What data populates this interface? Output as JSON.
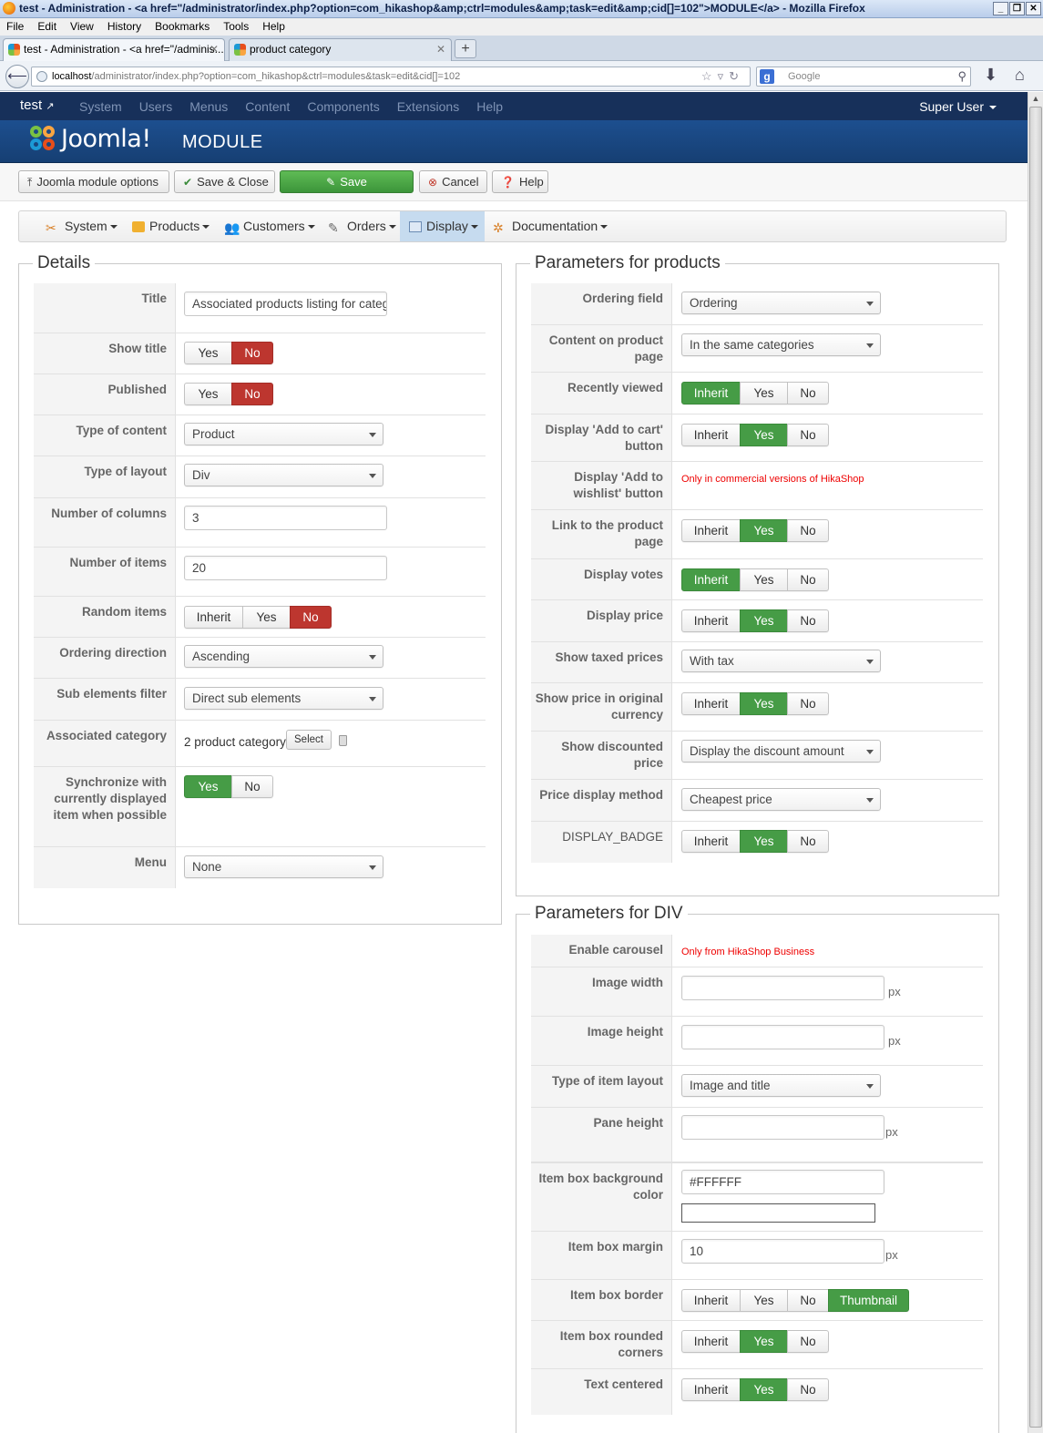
{
  "browser": {
    "window_title": "test - Administration - <a href=\"/administrator/index.php?option=com_hikashop&amp;ctrl=modules&amp;task=edit&amp;cid[]=102\">MODULE</a> - Mozilla Firefox",
    "menu": [
      "File",
      "Edit",
      "View",
      "History",
      "Bookmarks",
      "Tools",
      "Help"
    ],
    "tabs": [
      {
        "label": "test - Administration - <a href=\"/adminis..."
      },
      {
        "label": "product category"
      }
    ],
    "url_host": "localhost",
    "url_path": "/administrator/index.php?option=com_hikashop&ctrl=modules&task=edit&cid[]=102",
    "search_placeholder": "Google"
  },
  "joomla": {
    "site_name": "test",
    "menu": [
      "System",
      "Users",
      "Menus",
      "Content",
      "Components",
      "Extensions",
      "Help"
    ],
    "user": "Super User",
    "logo_text": "Joomla!",
    "page_title": "MODULE"
  },
  "toolbar": {
    "module_options": "Joomla module options",
    "save_close": "Save & Close",
    "save": "Save",
    "cancel": "Cancel",
    "help": "Help"
  },
  "hikanav": [
    "System",
    "Products",
    "Customers",
    "Orders",
    "Display",
    "Documentation"
  ],
  "details": {
    "legend": "Details",
    "title_label": "Title",
    "title_value": "Associated products listing for categ",
    "show_title_label": "Show title",
    "published_label": "Published",
    "type_content_label": "Type of content",
    "type_content_value": "Product",
    "type_layout_label": "Type of layout",
    "type_layout_value": "Div",
    "num_columns_label": "Number of columns",
    "num_columns_value": "3",
    "num_items_label": "Number of items",
    "num_items_value": "20",
    "random_label": "Random items",
    "ordering_dir_label": "Ordering direction",
    "ordering_dir_value": "Ascending",
    "sub_filter_label": "Sub elements filter",
    "sub_filter_value": "Direct sub elements",
    "assoc_cat_label": "Associated category",
    "assoc_cat_value": "2 product category",
    "select_btn": "Select",
    "sync_label": "Synchronize with currently displayed item when possible",
    "menu_label": "Menu",
    "menu_value": "None"
  },
  "buttons": {
    "yes": "Yes",
    "no": "No",
    "inherit": "Inherit",
    "thumbnail": "Thumbnail"
  },
  "products": {
    "legend": "Parameters for products",
    "ordering_field_label": "Ordering field",
    "ordering_field_value": "Ordering",
    "content_label": "Content on product page",
    "content_value": "In the same categories",
    "recently_label": "Recently viewed",
    "add_cart_label": "Display 'Add to cart' button",
    "wishlist_label": "Display 'Add to wishlist' button",
    "wishlist_note": "Only in commercial versions of HikaShop",
    "link_label": "Link to the product page",
    "votes_label": "Display votes",
    "price_label": "Display price",
    "taxed_label": "Show taxed prices",
    "taxed_value": "With tax",
    "orig_currency_label": "Show price in original currency",
    "discounted_label": "Show discounted price",
    "discounted_value": "Display the discount amount",
    "price_method_label": "Price display method",
    "price_method_value": "Cheapest price",
    "badge_label": "DISPLAY_BADGE"
  },
  "div": {
    "legend": "Parameters for DIV",
    "carousel_label": "Enable carousel",
    "carousel_note": "Only from HikaShop Business",
    "img_width_label": "Image width",
    "img_height_label": "Image height",
    "item_layout_label": "Type of item layout",
    "item_layout_value": "Image and title",
    "pane_height_label": "Pane height",
    "bg_color_label": "Item box background color",
    "bg_color_value": "#FFFFFF",
    "margin_label": "Item box margin",
    "margin_value": "10",
    "border_label": "Item box border",
    "rounded_label": "Item box rounded corners",
    "centered_label": "Text centered",
    "unit": "px"
  }
}
